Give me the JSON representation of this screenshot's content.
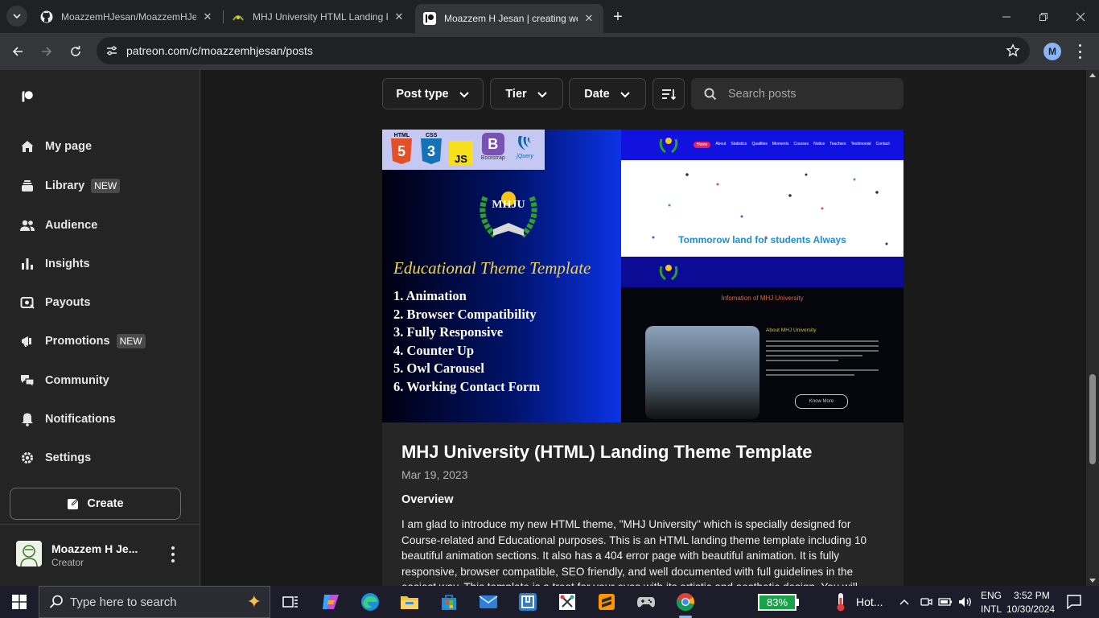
{
  "browser": {
    "tabs": [
      {
        "title": "MoazzemHJesan/MoazzemHJesan",
        "favicon": "github-icon",
        "active": false
      },
      {
        "title": "MHJ University HTML Landing Page",
        "favicon": "mhj-logo-icon",
        "active": false
      },
      {
        "title": "Moazzem H Jesan | creating web",
        "favicon": "patreon-icon",
        "active": true
      }
    ],
    "url": "patreon.com/c/moazzemhjesan/posts",
    "profile_initial": "M"
  },
  "sidebar": {
    "items": [
      {
        "label": "My page",
        "icon": "home-icon",
        "badge": ""
      },
      {
        "label": "Library",
        "icon": "library-icon",
        "badge": "NEW"
      },
      {
        "label": "Audience",
        "icon": "audience-icon",
        "badge": ""
      },
      {
        "label": "Insights",
        "icon": "insights-icon",
        "badge": ""
      },
      {
        "label": "Payouts",
        "icon": "payouts-icon",
        "badge": ""
      },
      {
        "label": "Promotions",
        "icon": "promotions-icon",
        "badge": "NEW"
      },
      {
        "label": "Community",
        "icon": "community-icon",
        "badge": ""
      },
      {
        "label": "Notifications",
        "icon": "notifications-icon",
        "badge": ""
      },
      {
        "label": "Settings",
        "icon": "settings-icon",
        "badge": ""
      }
    ],
    "create_label": "Create",
    "user": {
      "name": "Moazzem H Je...",
      "role": "Creator"
    }
  },
  "filters": {
    "post_type": "Post type",
    "tier": "Tier",
    "date": "Date",
    "search_placeholder": "Search posts"
  },
  "post": {
    "image": {
      "tech_badges": [
        "HTML",
        "CSS",
        "JS",
        "Bootstrap",
        "jQuery"
      ],
      "logo_text": "MHJU",
      "headline": "Educational Theme Template",
      "features": [
        "1. Animation",
        "2. Browser Compatibility",
        "3. Fully Responsive",
        "4. Counter Up",
        "5. Owl Carousel",
        "6. Working Contact Form"
      ],
      "preview_nav": [
        "Home",
        "About",
        "Statistics",
        "Qualities",
        "Moments",
        "Courses",
        "Notice",
        "Teachers",
        "Testimonial",
        "Contact"
      ],
      "preview_tagline": "Tommorow land for students Always",
      "preview_section": "Infomation of MHJ University",
      "preview_about": "About MHJ University",
      "preview_button": "Know More"
    },
    "title": "MHJ University (HTML) Landing Theme Template",
    "date": "Mar 19, 2023",
    "section_heading": "Overview",
    "body": "I am glad to introduce my new HTML theme, \"MHJ University\" which is specially designed for Course-related and Educational purposes. This is an HTML landing theme template including 10 beautiful animation sections. It also has a 404 error page with beautiful animation. It is fully responsive, browser compatible, SEO friendly, and well documented with full guidelines in the easiest way. This template is a treat for your eyes with its artistic and aesthetic design. You will"
  },
  "taskbar": {
    "search_placeholder": "Type here to search",
    "battery": "83%",
    "weather": "Hot...",
    "lang_top": "ENG",
    "lang_bottom": "INTL",
    "time": "3:52 PM",
    "date": "10/30/2024"
  }
}
